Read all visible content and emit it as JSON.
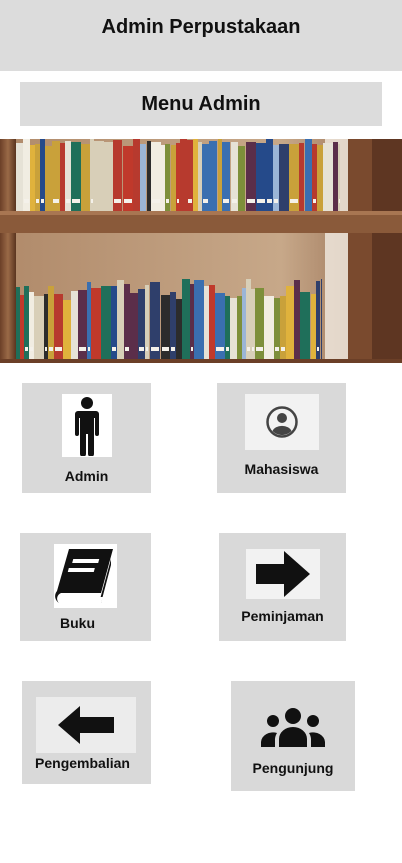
{
  "app": {
    "title": "Admin Perpustakaan"
  },
  "menu": {
    "title": "Menu Admin"
  },
  "hero": {
    "icon": "bookshelf-photo"
  },
  "tiles": [
    {
      "label": "Admin",
      "icon": "person-icon"
    },
    {
      "label": "Mahasiswa",
      "icon": "user-circle-icon"
    },
    {
      "label": "Buku",
      "icon": "book-icon"
    },
    {
      "label": "Peminjaman",
      "icon": "arrow-right-icon"
    },
    {
      "label": "Pengembalian",
      "icon": "arrow-left-icon"
    },
    {
      "label": "Pengunjung",
      "icon": "group-icon"
    }
  ],
  "colors": {
    "tile_bg": "#d9d9d9",
    "header_bg": "#dcdcdc",
    "wood": "#8a5a3a"
  }
}
